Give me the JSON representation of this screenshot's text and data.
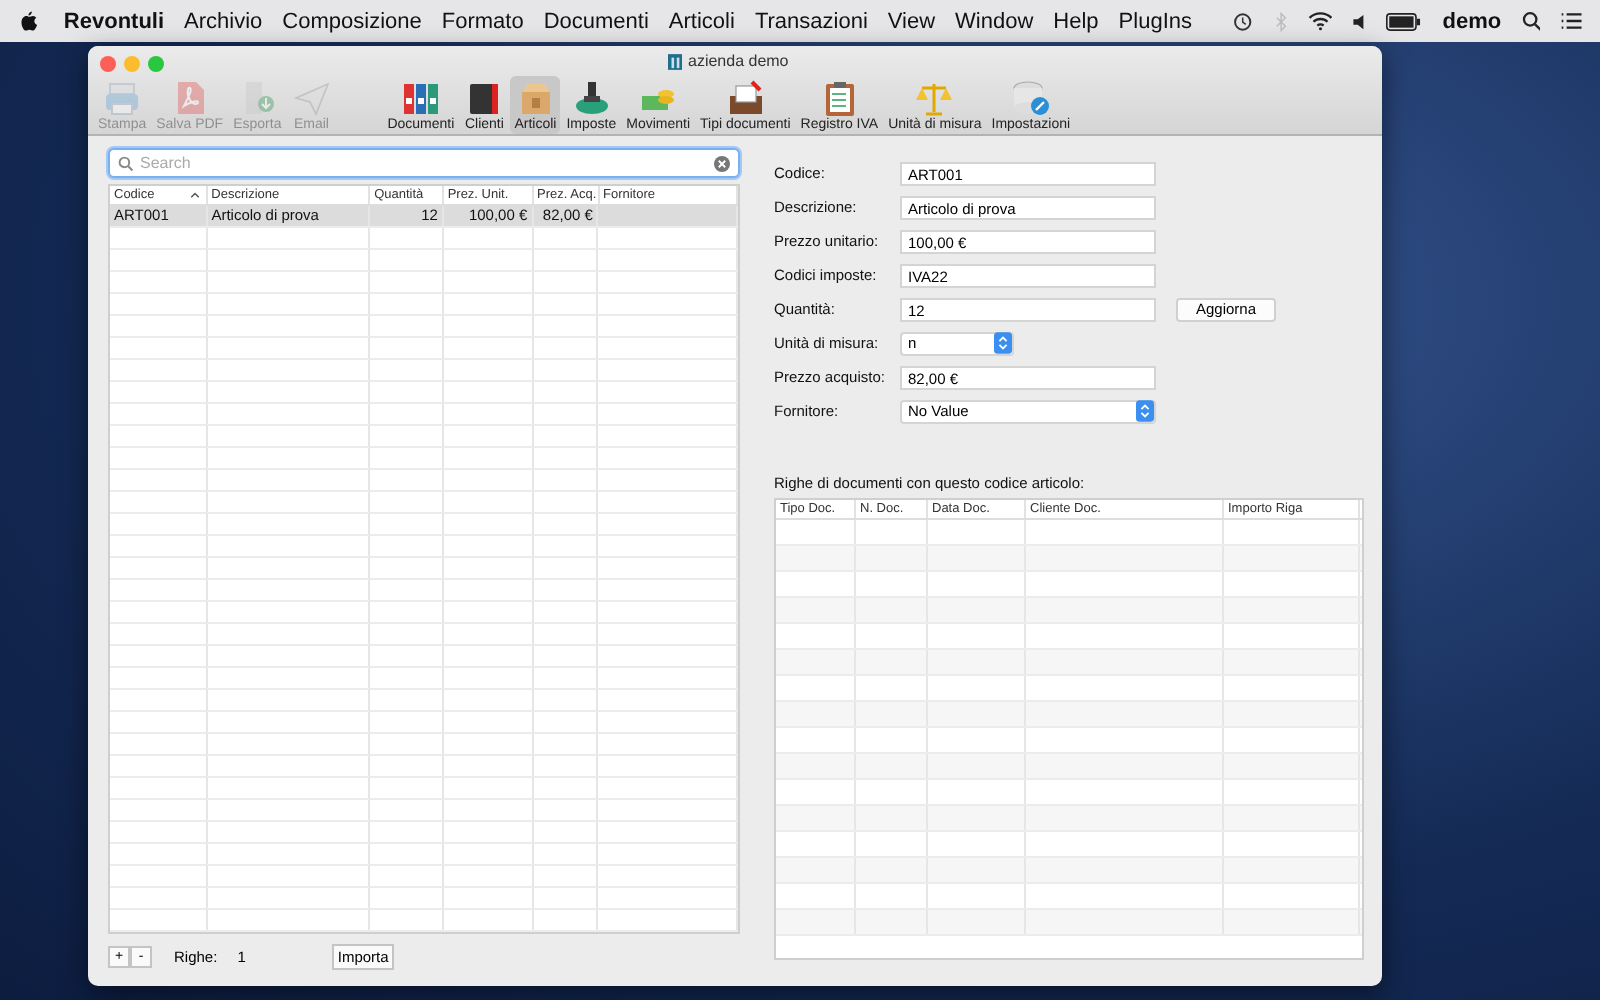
{
  "menu_bar": {
    "app": "Revontuli",
    "menus": [
      "Archivio",
      "Composizione",
      "Formato",
      "Documenti",
      "Articoli",
      "Transazioni",
      "View",
      "Window",
      "Help",
      "PlugIns"
    ],
    "user": "demo"
  },
  "window": {
    "title": "azienda demo"
  },
  "toolbar": {
    "left_items": [
      {
        "label": "Stampa",
        "disabled": true,
        "selected": false
      },
      {
        "label": "Salva PDF",
        "disabled": true,
        "selected": false
      },
      {
        "label": "Esporta",
        "disabled": true,
        "selected": false
      },
      {
        "label": "Email",
        "disabled": true,
        "selected": false
      }
    ],
    "items": [
      {
        "label": "Documenti",
        "disabled": false,
        "selected": false
      },
      {
        "label": "Clienti",
        "disabled": false,
        "selected": false
      },
      {
        "label": "Articoli",
        "disabled": false,
        "selected": true
      },
      {
        "label": "Imposte",
        "disabled": false,
        "selected": false
      },
      {
        "label": "Movimenti",
        "disabled": false,
        "selected": false
      },
      {
        "label": "Tipi documenti",
        "disabled": false,
        "selected": false
      },
      {
        "label": "Registro IVA",
        "disabled": false,
        "selected": false
      },
      {
        "label": "Unità di misura",
        "disabled": false,
        "selected": false
      },
      {
        "label": "Impostazioni",
        "disabled": false,
        "selected": false
      }
    ]
  },
  "search": {
    "placeholder": "Search"
  },
  "table": {
    "columns": [
      "Codice",
      "Descrizione",
      "Quantità",
      "Prez. Unit.",
      "Prez. Acq.",
      "Fornitore"
    ],
    "rows": [
      {
        "cells": [
          "ART001",
          "Articolo di prova",
          "12",
          "100,00 €",
          "82,00 €",
          ""
        ],
        "selected": true
      }
    ]
  },
  "bottom_bar": {
    "add": "+",
    "remove": "-",
    "count_label": "Righe:",
    "count": "1",
    "import": "Importa"
  },
  "form": {
    "fields": [
      {
        "kind": "text",
        "label": "Codice:",
        "value": "ART001"
      },
      {
        "kind": "text",
        "label": "Descrizione:",
        "value": "Articolo di prova"
      },
      {
        "kind": "text",
        "label": "Prezzo unitario:",
        "value": "100,00 €"
      },
      {
        "kind": "text",
        "label": "Codici imposte:",
        "value": "IVA22"
      },
      {
        "kind": "text",
        "label": "Quantità:",
        "value": "12",
        "button": "Aggiorna"
      },
      {
        "kind": "select_small",
        "label": "Unità di misura:",
        "value": "n"
      },
      {
        "kind": "text",
        "label": "Prezzo acquisto:",
        "value": "82,00 €"
      },
      {
        "kind": "select",
        "label": "Fornitore:",
        "value": "No Value"
      }
    ]
  },
  "documents": {
    "title": "Righe di documenti con questo codice articolo:",
    "columns": [
      "Tipo Doc.",
      "N. Doc.",
      "Data Doc.",
      "Cliente Doc.",
      "Importo Riga"
    ]
  }
}
